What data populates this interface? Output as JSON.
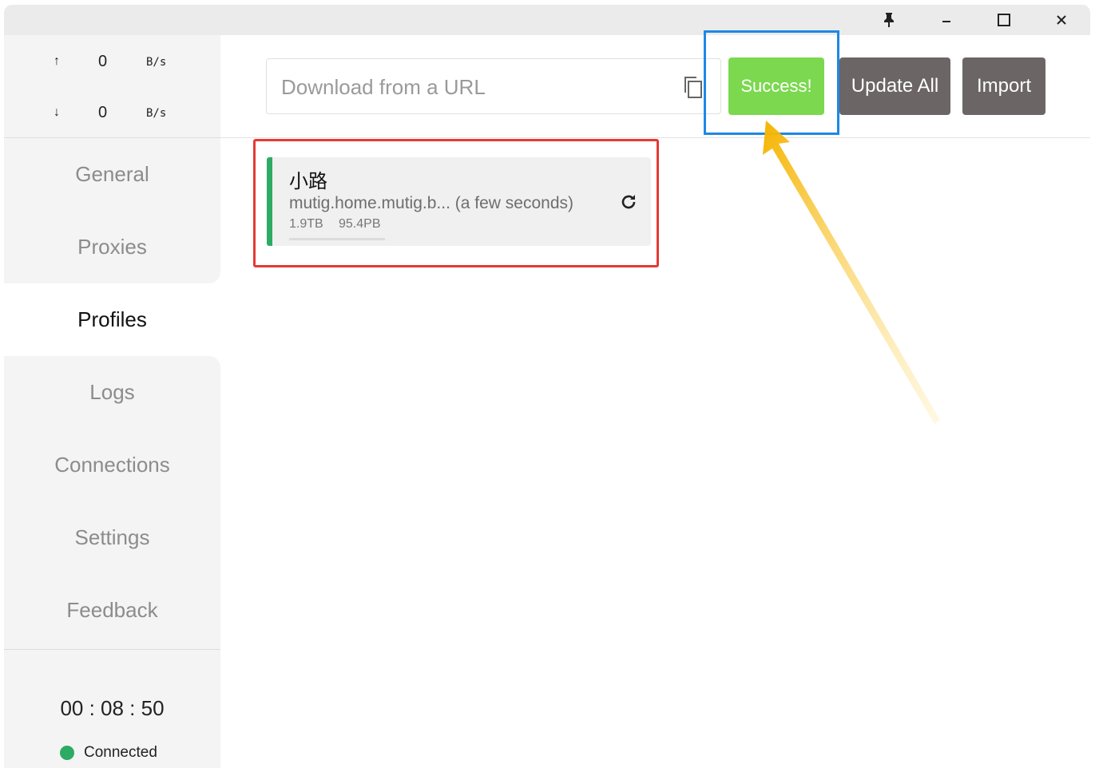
{
  "window": {
    "pin_icon": "pin-icon",
    "minimize_icon": "minimize-icon",
    "maximize_icon": "maximize-icon",
    "close_icon": "close-icon"
  },
  "traffic": {
    "up_arrow": "↑",
    "up_value": "0",
    "up_unit": "B/s",
    "down_arrow": "↓",
    "down_value": "0",
    "down_unit": "B/s"
  },
  "nav": {
    "items": [
      {
        "label": "General"
      },
      {
        "label": "Proxies"
      },
      {
        "label": "Profiles"
      },
      {
        "label": "Logs"
      },
      {
        "label": "Connections"
      },
      {
        "label": "Settings"
      },
      {
        "label": "Feedback"
      }
    ],
    "active_index": 2
  },
  "status": {
    "uptime": "00 : 08 : 50",
    "connection": "Connected",
    "connection_color": "#2daa63"
  },
  "toolbar": {
    "url_placeholder": "Download from a URL",
    "url_value": "",
    "copy_icon": "copy-icon",
    "success_label": "Success!",
    "update_all_label": "Update All",
    "import_label": "Import"
  },
  "profiles": [
    {
      "name": "小路",
      "url": "mutig.home.mutig.b...",
      "updated": "(a few seconds)",
      "used": "1.9TB",
      "total": "95.4PB",
      "refresh_icon": "refresh-icon"
    }
  ],
  "annotations": {
    "red_box_color": "#e53935",
    "blue_box_color": "#1e88e5",
    "arrow_color": "#f5b400"
  }
}
